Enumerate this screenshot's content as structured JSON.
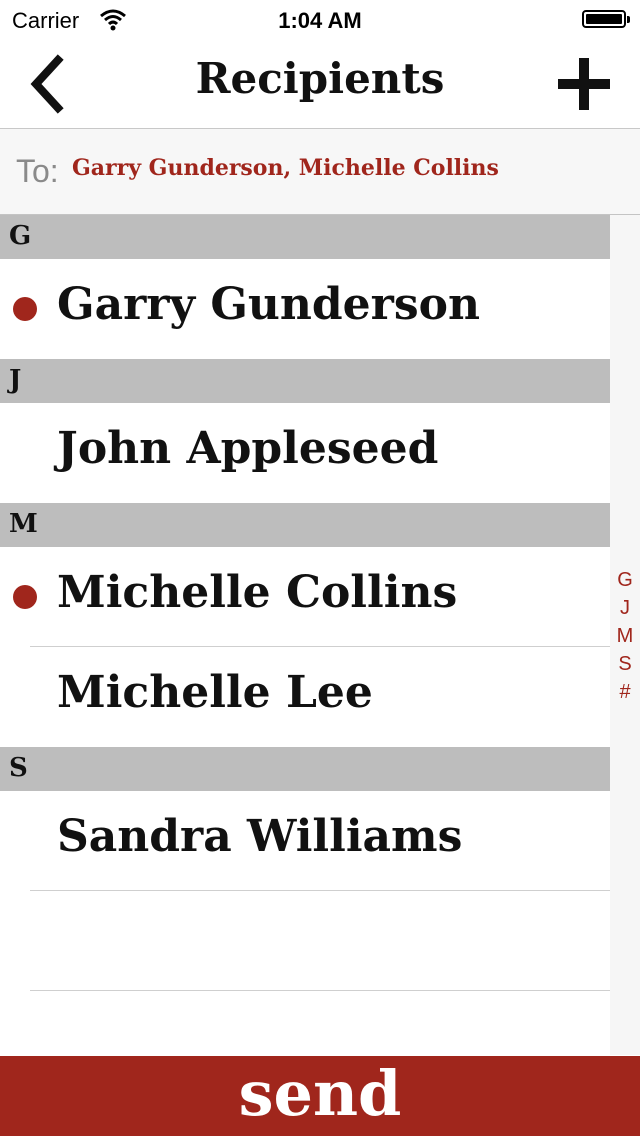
{
  "status_bar": {
    "carrier": "Carrier",
    "time": "1:04 AM",
    "wifi_icon": "wifi-icon",
    "battery_icon": "battery-icon"
  },
  "nav": {
    "title": "Recipients",
    "back_icon": "chevron-left-icon",
    "add_icon": "plus-icon"
  },
  "to_field": {
    "label": "To:",
    "value": "Garry Gunderson, Michelle Collins"
  },
  "sections": [
    {
      "letter": "G",
      "contacts": [
        {
          "name": "Garry Gunderson",
          "selected": true
        }
      ]
    },
    {
      "letter": "J",
      "contacts": [
        {
          "name": "John Appleseed",
          "selected": false
        }
      ]
    },
    {
      "letter": "M",
      "contacts": [
        {
          "name": "Michelle Collins",
          "selected": true
        },
        {
          "name": "Michelle Lee",
          "selected": false
        }
      ]
    },
    {
      "letter": "S",
      "contacts": [
        {
          "name": "Sandra Williams",
          "selected": false
        }
      ]
    }
  ],
  "index": [
    "G",
    "J",
    "M",
    "S",
    "#"
  ],
  "send_label": "send",
  "colors": {
    "accent": "#a0261c",
    "section_header": "#bdbdbd"
  }
}
